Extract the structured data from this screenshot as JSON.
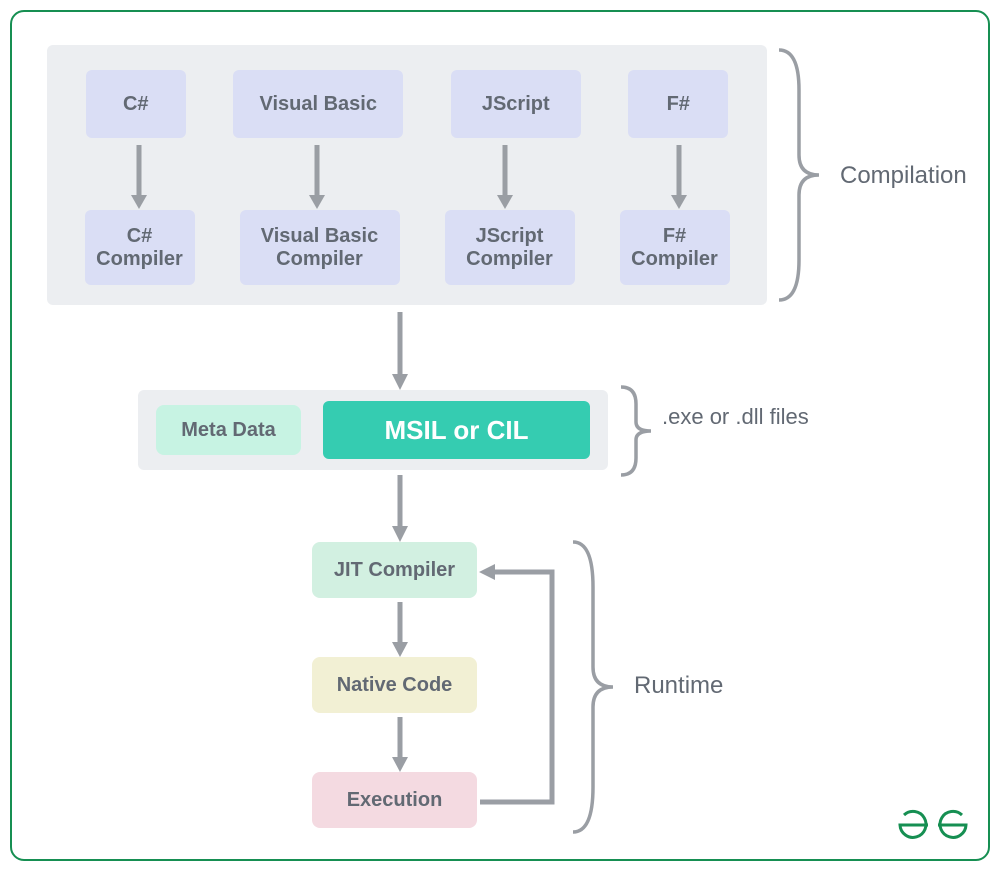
{
  "compilation": {
    "label": "Compilation",
    "languages": [
      {
        "name": "C#",
        "compiler": "C# Compiler"
      },
      {
        "name": "Visual Basic",
        "compiler": "Visual Basic Compiler"
      },
      {
        "name": "JScript",
        "compiler": "JScript Compiler"
      },
      {
        "name": "F#",
        "compiler": "F# Compiler"
      }
    ]
  },
  "il": {
    "label": ".exe or .dll files",
    "metadata": "Meta Data",
    "msil": "MSIL or CIL"
  },
  "runtime": {
    "label": "Runtime",
    "jit": "JIT Compiler",
    "native": "Native Code",
    "execution": "Execution"
  }
}
